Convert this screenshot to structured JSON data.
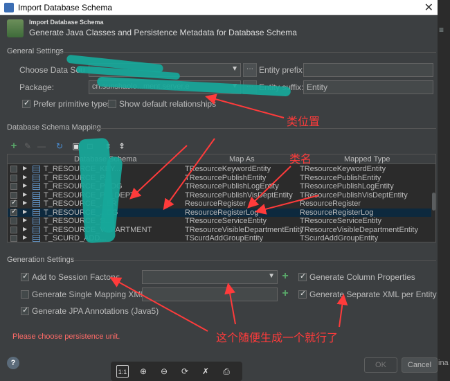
{
  "window": {
    "title": "Import Database Schema",
    "close_glyph": "✕"
  },
  "header": {
    "small_title": "Import Database Schema",
    "main_title": "Generate Java Classes and Persistence Metadata for Database Schema"
  },
  "general_settings": {
    "section_title": "General Settings",
    "choose_data_source_label": "Choose Data Sou",
    "choose_data_source_value": "",
    "dots_label": "···",
    "entity_prefix_label": "Entity prefix:",
    "entity_prefix_value": "",
    "package_label": "Package:",
    "package_value": "cn.sunshaolo...ment.server.e",
    "entity_suffix_label": "Entity suffix:",
    "entity_suffix_value": "Entity",
    "prefer_primitive_label": "Prefer primitive types",
    "prefer_primitive_checked": true,
    "show_default_rel_label": "Show default relationships",
    "show_default_rel_checked": false
  },
  "mapping": {
    "section_title": "Database Schema Mapping",
    "columns": [
      "Database Schema",
      "Map As",
      "Mapped Type"
    ],
    "rows": [
      {
        "checked": false,
        "table": "T_RESOURCE_KEY...",
        "map_as": "TResourceKeywordEntity",
        "mapped_type": "TResourceKeywordEntity",
        "selected": false
      },
      {
        "checked": false,
        "table": "T_RESOURCE_P...",
        "map_as": "TResourcePublishEntity",
        "mapped_type": "TResourcePublishEntity",
        "selected": false
      },
      {
        "checked": false,
        "table": "T_RESOURCE_P...OG",
        "map_as": "TResourcePublishLogEntity",
        "mapped_type": "TResourcePublishLogEntity",
        "selected": false
      },
      {
        "checked": false,
        "table": "T_RESOURCE_P..._DEPT",
        "map_as": "TResourcePublishVisDeptEntity",
        "mapped_type": "TResourcePublishVisDeptEntity",
        "selected": false
      },
      {
        "checked": true,
        "table": "T_RESOURCE_...ER",
        "map_as": "ResourceRegister",
        "mapped_type": "ResourceRegister",
        "selected": false
      },
      {
        "checked": true,
        "table": "T_RESOURCE_...OG",
        "map_as": "ResourceRegisterLog",
        "mapped_type": "ResourceRegisterLog",
        "selected": true
      },
      {
        "checked": false,
        "table": "T_RESOURCE_S...",
        "map_as": "TResourceServiceEntity",
        "mapped_type": "TResourceServiceEntity",
        "selected": false
      },
      {
        "checked": false,
        "table": "T_RESOURCE_V...PARTMENT",
        "map_as": "TResourceVisibleDepartmentEntity",
        "mapped_type": "TResourceVisibleDepartmentEntity",
        "selected": false
      },
      {
        "checked": false,
        "table": "T_SCURD_ADD...",
        "map_as": "TScurdAddGroupEntity",
        "mapped_type": "TScurdAddGroupEntity",
        "selected": false
      }
    ]
  },
  "generation": {
    "section_title": "Generation Settings",
    "add_session_factory_label": "Add to Session Factory:",
    "add_session_factory_checked": true,
    "generate_single_label": "Generate Single Mapping XML:",
    "generate_single_checked": false,
    "generate_jpa_label": "Generate JPA Annotations (Java5)",
    "generate_jpa_checked": true,
    "generate_column_label": "Generate Column Properties",
    "generate_column_checked": true,
    "generate_separate_label": "Generate Separate XML per Entity",
    "generate_separate_checked": true,
    "plus_glyph": "+"
  },
  "footer": {
    "error": "Please choose persistence unit.",
    "help": "?",
    "ok": "OK",
    "cancel": "Cancel"
  },
  "viewer": {
    "buttons": [
      "1:1",
      "⊕",
      "⊖",
      "⟳",
      "✗",
      "⎙"
    ]
  },
  "annotations": {
    "class_location": "类位置",
    "class_name": "类名",
    "random": "这个随便生成一个就行了"
  },
  "colors": {
    "background": "#3c3f41",
    "annotation": "#ff3b3b",
    "scribble": "#17a89a",
    "selected_row": "#0d293e"
  }
}
